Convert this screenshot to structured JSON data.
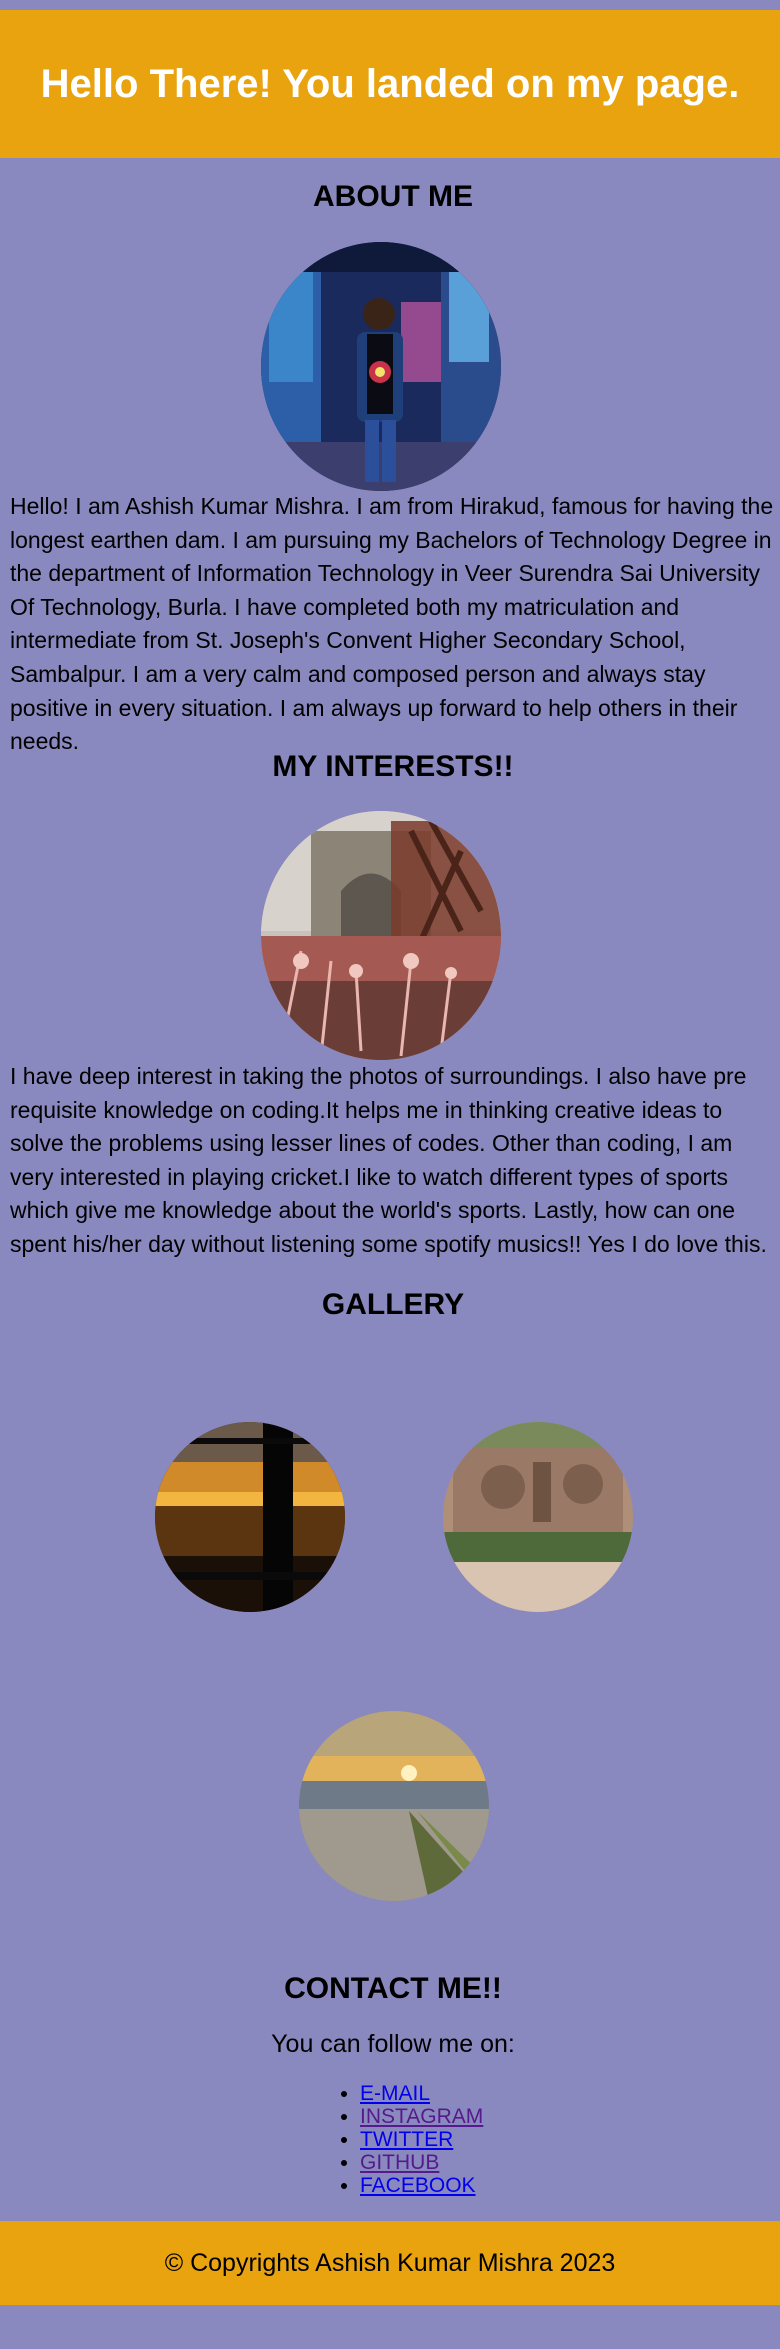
{
  "header": {
    "title": "Hello There! You landed on my page."
  },
  "about": {
    "title": "ABOUT ME",
    "text": "Hello! I am Ashish Kumar Mishra. I am from Hirakud, famous for having the longest earthen dam. I am pursuing my Bachelors of Technology Degree in the department of Information Technology in Veer Surendra Sai University Of Technology, Burla. I have completed both my matriculation and intermediate from St. Joseph's Convent Higher Secondary School, Sambalpur. I am a very calm and composed person and always stay positive in every situation. I am always up forward to help others in their needs."
  },
  "interests": {
    "title": "MY INTERESTS!!",
    "text": "I have deep interest in taking the photos of surroundings. I also have pre requisite knowledge on coding.It helps me in thinking creative ideas to solve the problems using lesser lines of codes. Other than coding, I am very interested in playing cricket.I like to watch different types of sports which give me knowledge about the world's sports. Lastly, how can one spent his/her day without listening some spotify musics!! Yes I do love this."
  },
  "gallery": {
    "title": "GALLERY"
  },
  "contact": {
    "title": "CONTACT ME!!",
    "subtitle": "You can follow me on:",
    "links": [
      {
        "label": "E-MAIL",
        "color": "#0000ee"
      },
      {
        "label": "INSTAGRAM",
        "color": "#551a8b"
      },
      {
        "label": "TWITTER",
        "color": "#0000ee"
      },
      {
        "label": "GITHUB",
        "color": "#551a8b"
      },
      {
        "label": "FACEBOOK",
        "color": "#0000ee"
      }
    ]
  },
  "footer": {
    "text": "© Copyrights Ashish Kumar Mishra 2023"
  },
  "colors": {
    "page_bg": "#8a89bf",
    "accent": "#e8a30f",
    "header_text": "#ffffff"
  }
}
